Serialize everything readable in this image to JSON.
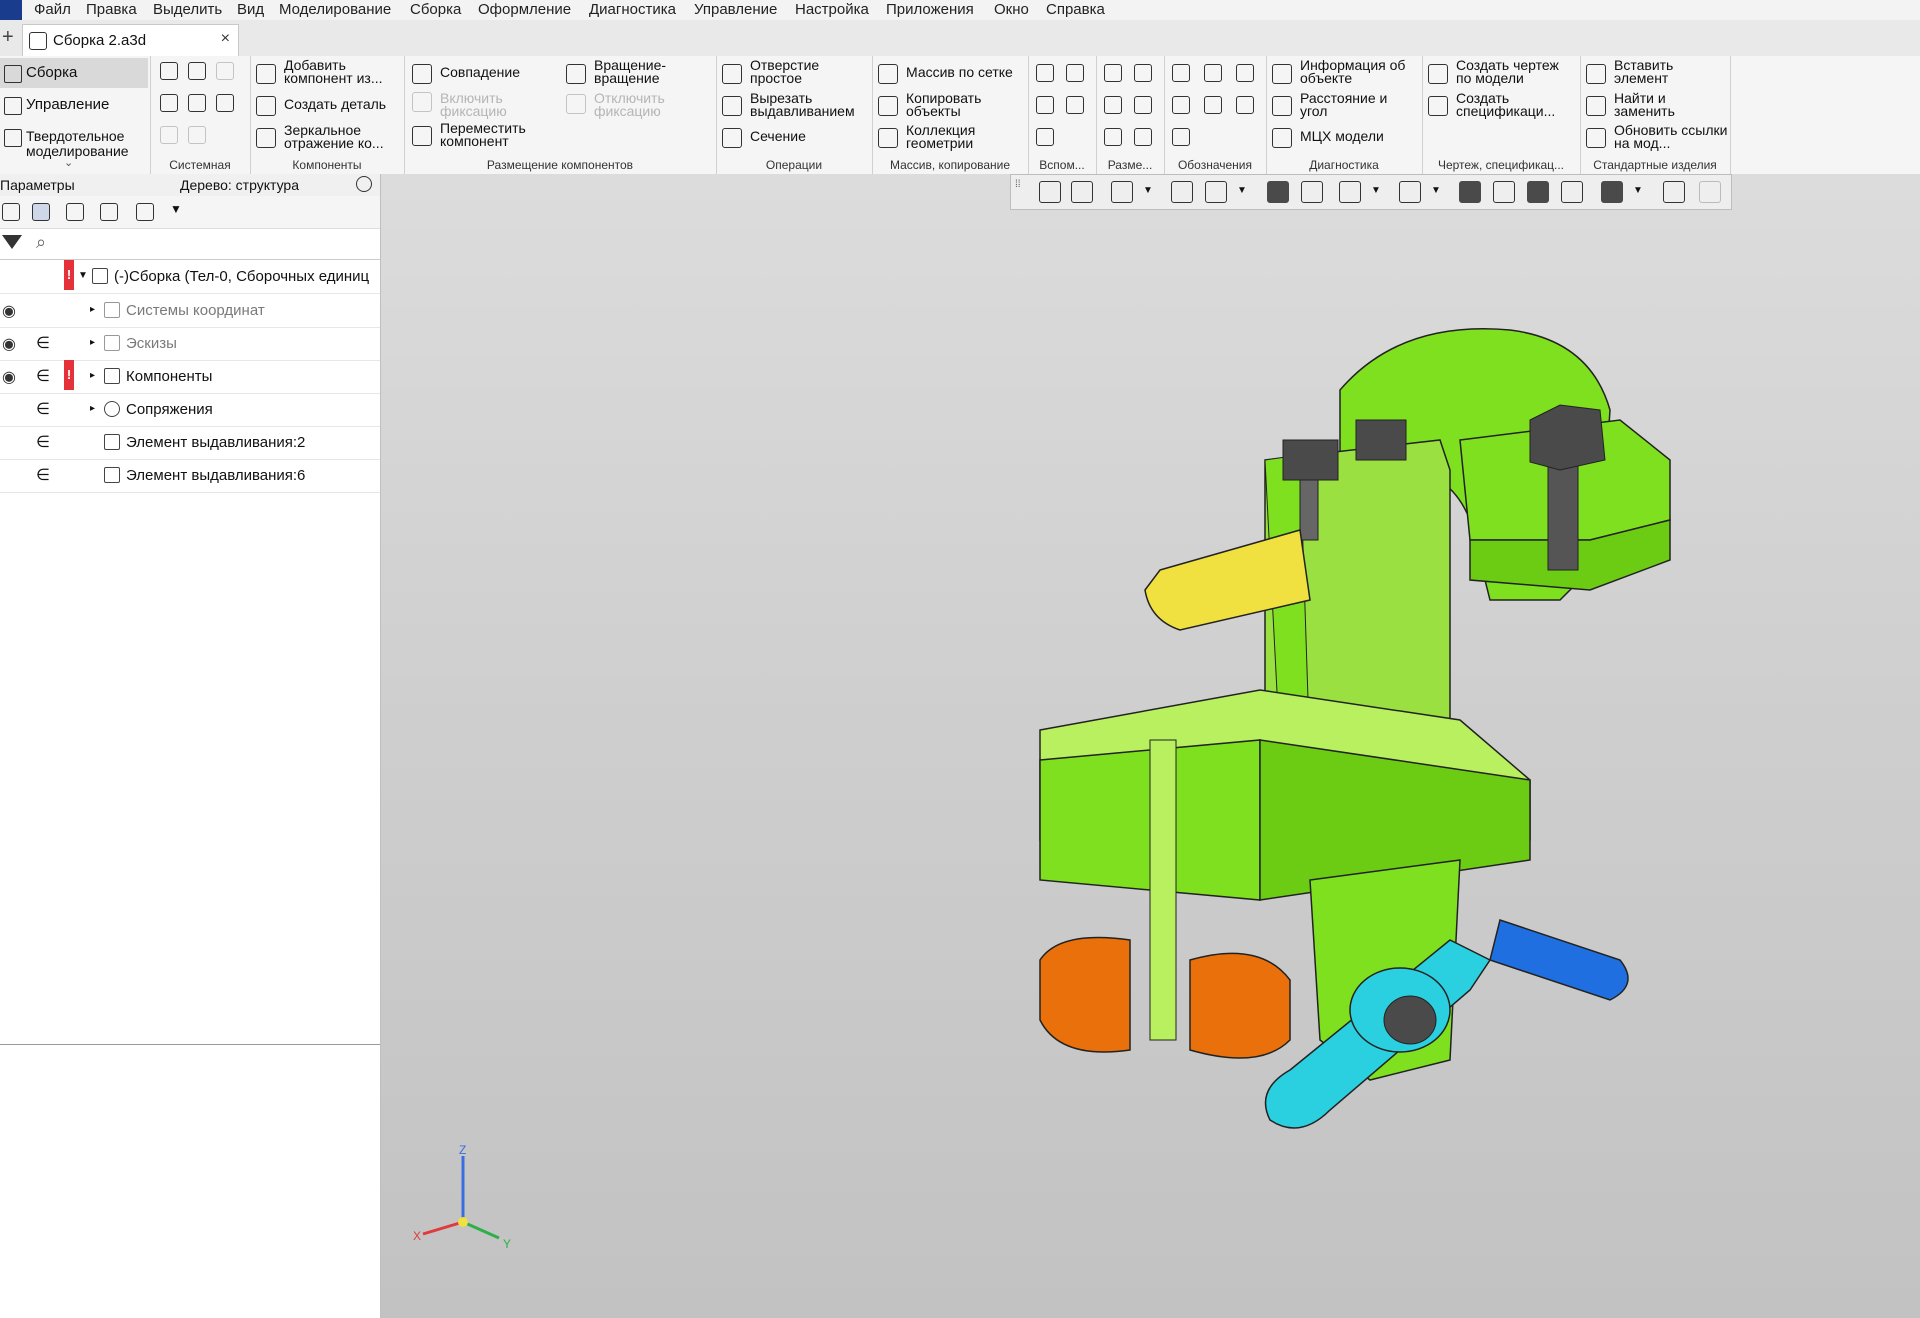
{
  "menu": [
    "Файл",
    "Правка",
    "Выделить",
    "Вид",
    "Моделирование",
    "Сборка",
    "Оформление",
    "Диагностика",
    "Управление",
    "Настройка",
    "Приложения",
    "Окно",
    "Справка"
  ],
  "document_tab": {
    "title": "Сборка 2.a3d",
    "close": "×",
    "new": "+"
  },
  "modes": [
    {
      "label": "Сборка"
    },
    {
      "label": "Управление"
    },
    {
      "label": "Твердотельное\nмоделирование"
    }
  ],
  "ribbon": {
    "groups": [
      "Системная",
      "Компоненты",
      "Размещение компонентов",
      "Операции",
      "Массив, копирование",
      "Вспом...",
      "Разме...",
      "Обозначения",
      "Диагностика",
      "Чертеж, спецификац...",
      "Стандартные изделия"
    ],
    "components": [
      "Добавить компонент из...",
      "Создать деталь",
      "Зеркальное отражение ко..."
    ],
    "placement": [
      "Совпадение",
      "Включить фиксацию",
      "Переместить компонент",
      "Вращение-вращение",
      "Отключить фиксацию"
    ],
    "operations": [
      "Отверстие простое",
      "Вырезать выдавливанием",
      "Сечение"
    ],
    "array": [
      "Массив по сетке",
      "Копировать объекты",
      "Коллекция геометрии"
    ],
    "diagnostics": [
      "Информация об объекте",
      "Расстояние и угол",
      "МЦХ модели"
    ],
    "drawing": [
      "Создать чертеж по модели",
      "Создать спецификаци..."
    ],
    "standard": [
      "Вставить элемент",
      "Найти и заменить",
      "Обновить ссылки на мод..."
    ]
  },
  "panel": {
    "tab_params": "Параметры",
    "tab_tree": "Дерево: структура",
    "search_icon": "⌕",
    "tree": [
      {
        "label": "(-)Сборка (Тел-0, Сборочных единиц",
        "gray": false,
        "warn": true
      },
      {
        "label": "Системы координат",
        "gray": true,
        "warn": false
      },
      {
        "label": "Эскизы",
        "gray": true,
        "warn": false
      },
      {
        "label": "Компоненты",
        "gray": false,
        "warn": true
      },
      {
        "label": "Сопряжения",
        "gray": false,
        "warn": false
      },
      {
        "label": "Элемент выдавливания:2",
        "gray": false,
        "warn": false
      },
      {
        "label": "Элемент выдавливания:6",
        "gray": false,
        "warn": false
      }
    ],
    "warn_mark": "!",
    "membership": "∈"
  },
  "axes": {
    "x": "X",
    "y": "Y",
    "z": "Z"
  },
  "colors": {
    "green": "#7fe020",
    "light_green": "#b8f060",
    "orange": "#e9700a",
    "cyan": "#2ad0e0",
    "blue": "#1f6fe0",
    "yellow": "#f0e040",
    "warn": "#e5323a"
  }
}
